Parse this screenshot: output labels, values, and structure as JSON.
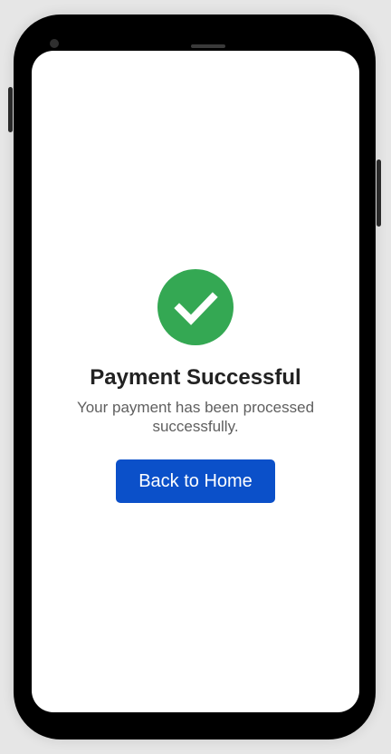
{
  "success": {
    "icon": "check-circle-icon",
    "title": "Payment Successful",
    "message": "Your payment has been processed successfully."
  },
  "actions": {
    "back_home_label": "Back to Home"
  },
  "colors": {
    "success_green": "#34a853",
    "primary_button": "#0b50c9",
    "background": "#e6e6e6",
    "screen": "#ffffff"
  }
}
